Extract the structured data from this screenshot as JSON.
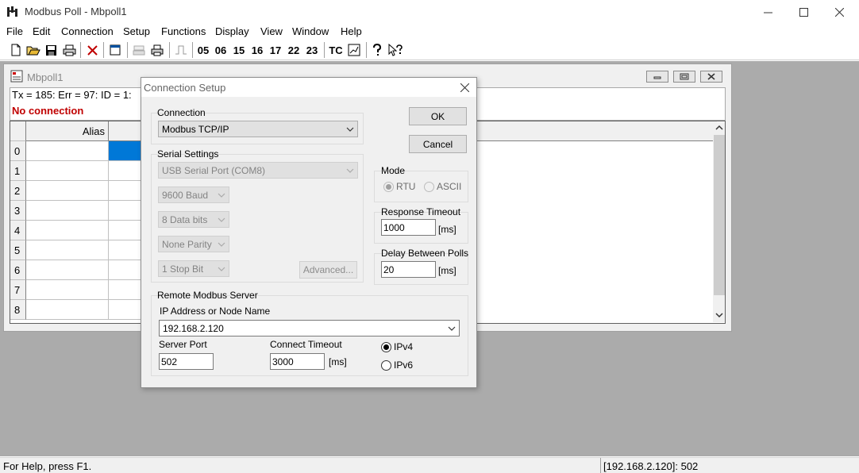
{
  "app": {
    "title": "Modbus Poll - Mbpoll1"
  },
  "menu": [
    "File",
    "Edit",
    "Connection",
    "Setup",
    "Functions",
    "Display",
    "View",
    "Window",
    "Help"
  ],
  "toolbar": {
    "function_codes": [
      "05",
      "06",
      "15",
      "16",
      "17",
      "22",
      "23"
    ],
    "tc_label": "TC"
  },
  "child": {
    "title": "Mbpoll1",
    "status_line": "Tx = 185: Err = 97: ID = 1:",
    "error_line": "No connection",
    "grid": {
      "alias_header": "Alias",
      "rows": [
        "0",
        "1",
        "2",
        "3",
        "4",
        "5",
        "6",
        "7",
        "8"
      ]
    }
  },
  "statusbar": {
    "help": "For Help, press F1.",
    "connection": "[192.168.2.120]: 502"
  },
  "dialog": {
    "title": "Connection Setup",
    "connection_label": "Connection",
    "connection_value": "Modbus TCP/IP",
    "ok_label": "OK",
    "cancel_label": "Cancel",
    "serial_settings_label": "Serial Settings",
    "serial_port": "USB Serial Port (COM8)",
    "baud": "9600 Baud",
    "data_bits": "8 Data bits",
    "parity": "None Parity",
    "stop_bits": "1 Stop Bit",
    "advanced_label": "Advanced...",
    "mode_label": "Mode",
    "mode_rtu": "RTU",
    "mode_ascii": "ASCII",
    "mode_selected": "RTU",
    "response_timeout_label": "Response Timeout",
    "response_timeout_value": "1000",
    "delay_label": "Delay Between Polls",
    "delay_value": "20",
    "ms_unit": "[ms]",
    "remote_label": "Remote Modbus Server",
    "ip_label": "IP Address or Node Name",
    "ip_value": "192.168.2.120",
    "server_port_label": "Server Port",
    "server_port_value": "502",
    "connect_timeout_label": "Connect Timeout",
    "connect_timeout_value": "3000",
    "ipv4_label": "IPv4",
    "ipv6_label": "IPv6",
    "ip_version_selected": "IPv4"
  }
}
